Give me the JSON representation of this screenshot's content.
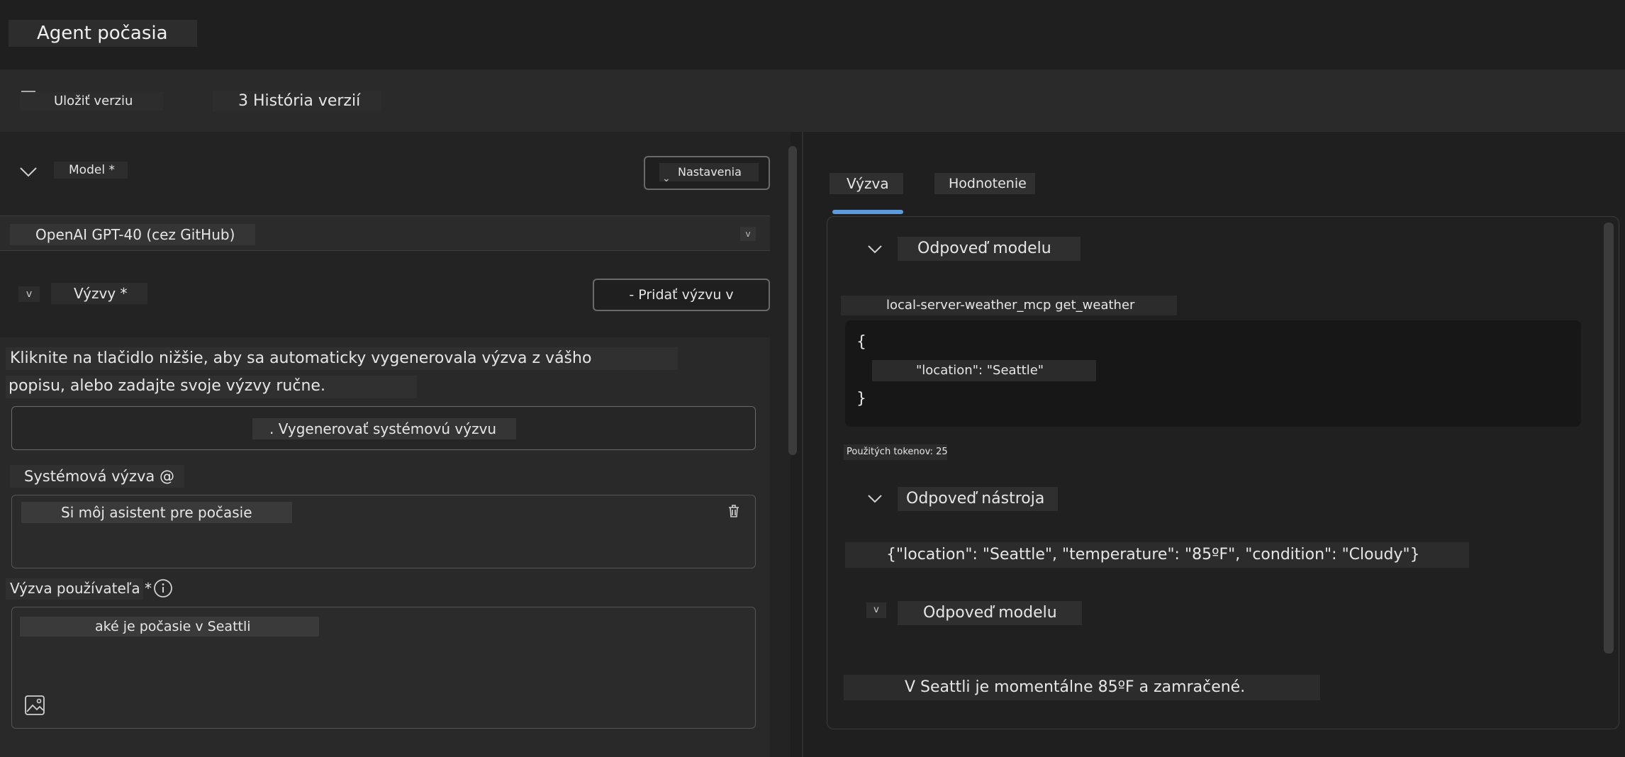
{
  "app": {
    "title": "Agent počasia"
  },
  "toolbar": {
    "save_label": "Uložiť verziu",
    "history_label": "3 História verzií"
  },
  "model_section": {
    "label": "Model *",
    "settings_label": "Nastavenia",
    "selected_model": "OpenAI GPT-40 (cez GitHub)"
  },
  "prompts_section": {
    "label": "Výzvy *",
    "add_prompt_label": "- Pridať výzvu v",
    "help_line1": "Kliknite na tlačidlo nižšie, aby sa automaticky vygenerovala výzva z vášho",
    "help_line2": "popisu, alebo zadajte svoje výzvy ručne.",
    "generate_label": ". Vygenerovať systémovú výzvu",
    "system_label": "Systémová výzva @",
    "system_value": "Si môj asistent pre počasie",
    "user_label": "Výzva používateľa *",
    "user_value": "aké je počasie v Seattli"
  },
  "tabs": [
    {
      "label": "Výzva",
      "active": true
    },
    {
      "label": "Hodnotenie",
      "active": false
    }
  ],
  "output": {
    "model_response_1": "Odpoveď modelu",
    "tool_call_name": "local-server-weather_mcp get_weather",
    "code_open": "{",
    "code_body": "\"location\": \"Seattle\"",
    "code_close": "}",
    "tokens": "Použitých tokenov: 25",
    "tool_response_title": "Odpoveď nástroja",
    "tool_response_value": "{\"location\": \"Seattle\", \"temperature\": \"85ºF\", \"condition\": \"Cloudy\"}",
    "model_response_2": "Odpoveď modelu",
    "final_answer": "V Seattli je momentálne 85ºF a zamračené."
  },
  "colors": {
    "accent": "#5b9bdb",
    "background": "#1f1f1f",
    "panel": "#2a2a2a"
  },
  "icons": [
    "chevron-down-icon",
    "trash-icon",
    "info-icon",
    "image-icon",
    "dropdown-caret-icon"
  ]
}
